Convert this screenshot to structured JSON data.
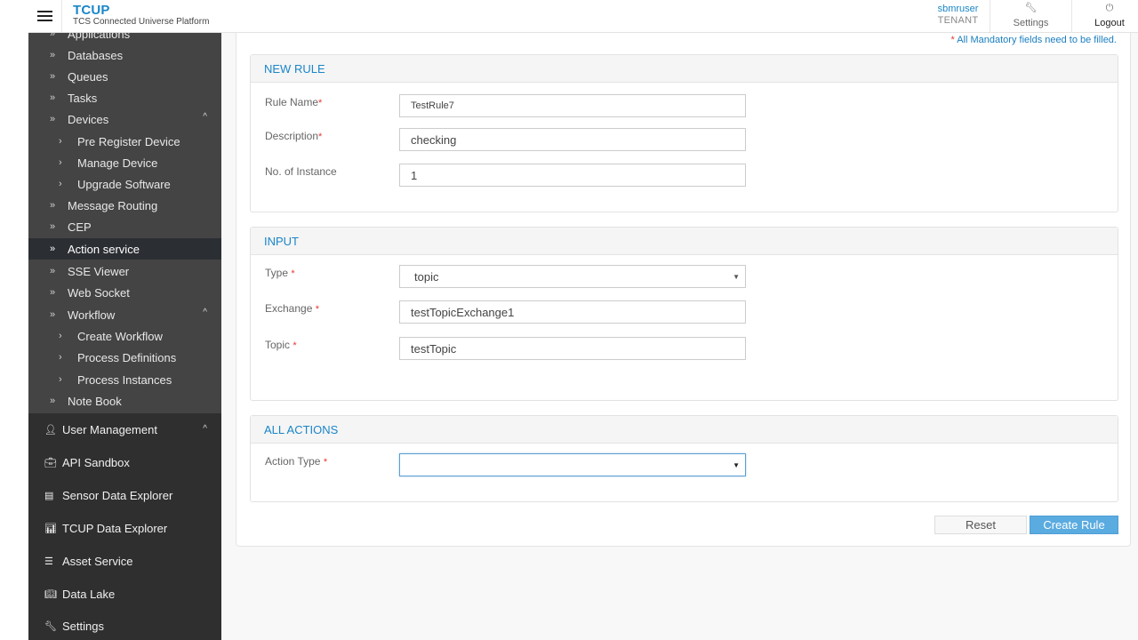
{
  "header": {
    "brand_title": "TCUP",
    "brand_subtitle": "TCS Connected Universe Platform",
    "user_name": "sbmruser",
    "user_role": "TENANT",
    "settings_label": "Settings",
    "logout_label": "Logout",
    "settings_icon": "wrench-icon",
    "logout_icon": "power-icon",
    "menu_icon": "hamburger-icon"
  },
  "sidebar": {
    "submenu_items": [
      {
        "label": "Applications",
        "level": 1
      },
      {
        "label": "Databases",
        "level": 1
      },
      {
        "label": "Queues",
        "level": 1
      },
      {
        "label": "Tasks",
        "level": 1
      },
      {
        "label": "Devices",
        "level": 1,
        "expanded": true
      },
      {
        "label": "Pre Register Device",
        "level": 2
      },
      {
        "label": "Manage Device",
        "level": 2
      },
      {
        "label": "Upgrade Software",
        "level": 2
      },
      {
        "label": "Message Routing",
        "level": 1
      },
      {
        "label": "CEP",
        "level": 1
      },
      {
        "label": "Action service",
        "level": 1,
        "active": true
      },
      {
        "label": "SSE Viewer",
        "level": 1
      },
      {
        "label": "Web Socket",
        "level": 1
      },
      {
        "label": "Workflow",
        "level": 1,
        "expanded": true
      },
      {
        "label": "Create Workflow",
        "level": 2
      },
      {
        "label": "Process Definitions",
        "level": 2
      },
      {
        "label": "Process Instances",
        "level": 2
      },
      {
        "label": "Note Book",
        "level": 1
      }
    ],
    "main_items": [
      {
        "label": "User Management",
        "icon": "user-icon",
        "expanded": true
      },
      {
        "label": "API Sandbox",
        "icon": "briefcase-icon"
      },
      {
        "label": "Sensor Data Explorer",
        "icon": "monitor-icon"
      },
      {
        "label": "TCUP Data Explorer",
        "icon": "bar-chart-icon"
      },
      {
        "label": "Asset Service",
        "icon": "list-icon"
      },
      {
        "label": "Data Lake",
        "icon": "book-icon"
      },
      {
        "label": "Settings",
        "icon": "wrench-icon"
      }
    ]
  },
  "main": {
    "mandatory_note_star": "*",
    "mandatory_note": " All Mandatory fields need to be filled.",
    "new_rule": {
      "title": "NEW RULE",
      "rule_name_label": "Rule Name",
      "rule_name_value": "TestRule7",
      "description_label": "Description",
      "description_value": "checking",
      "instances_label": "No. of Instance",
      "instances_value": "1"
    },
    "input": {
      "title": "INPUT",
      "type_label": "Type ",
      "type_value": "topic",
      "exchange_label": "Exchange ",
      "exchange_value": "testTopicExchange1",
      "topic_label": "Topic ",
      "topic_value": "testTopic"
    },
    "all_actions": {
      "title": "ALL ACTIONS",
      "action_type_label": "Action Type ",
      "action_type_value": ""
    },
    "required_star": "*",
    "reset_label": "Reset",
    "create_label": "Create Rule"
  },
  "colors": {
    "accent": "#1a86c8",
    "primary_button": "#5aabe0",
    "required": "#e53935",
    "sidebar_dark": "#2f2f2f",
    "sidebar_submenu": "#444444"
  }
}
